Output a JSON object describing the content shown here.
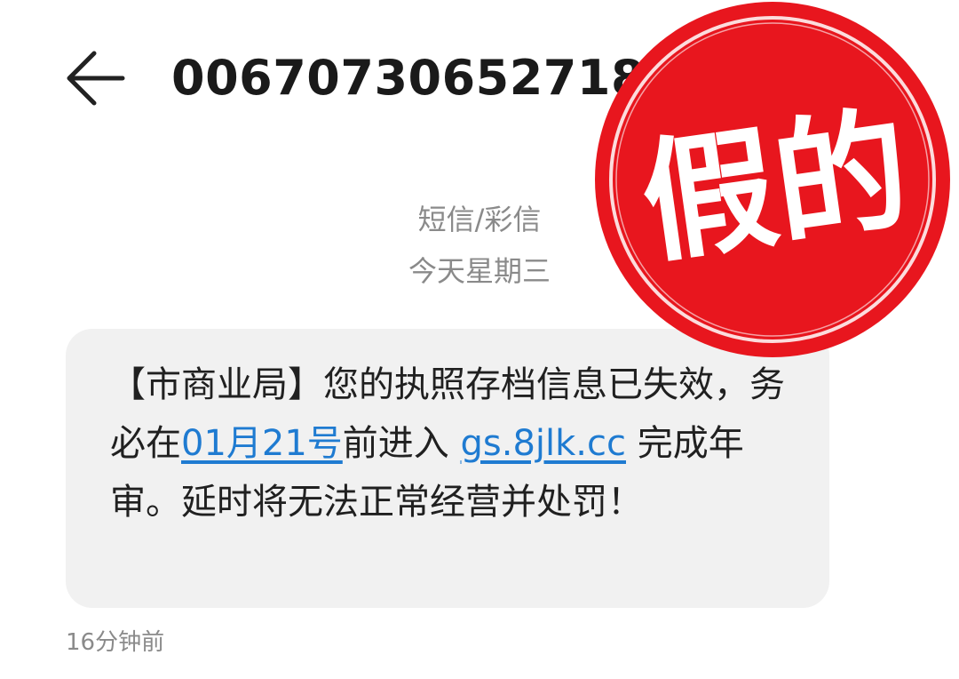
{
  "header": {
    "back_icon": "arrow-left-icon",
    "title": "00670730652718",
    "more_icon": "more-icon"
  },
  "thread": {
    "message_type": "短信/彩信",
    "date_label": "今天星期三"
  },
  "message": {
    "text_before_date": "【市商业局】您的执照存档信息已失效，务必在",
    "date_link": "01月21号",
    "text_before_url": "前进入 ",
    "url_link": "gs.8jlk.cc",
    "text_after_url": " 完成年审。延时将无法正常经营并处罚！",
    "link_color": "#1f7bd1",
    "bubble_color": "#f1f1f1"
  },
  "timestamp": "16分钟前",
  "stamp": {
    "text": "假的",
    "color": "#e8161e"
  }
}
